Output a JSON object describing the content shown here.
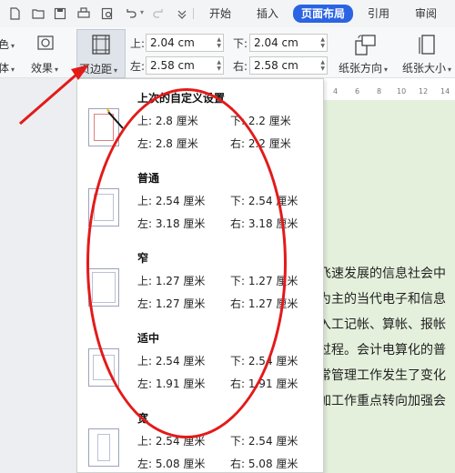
{
  "menubar": {
    "tabs": [
      {
        "label": "开始",
        "active": false
      },
      {
        "label": "插入",
        "active": false
      },
      {
        "label": "页面布局",
        "active": true
      },
      {
        "label": "引用",
        "active": false
      },
      {
        "label": "审阅",
        "active": false
      }
    ]
  },
  "ribbon": {
    "color_label": "色",
    "theme_label": "体",
    "effects_label": "效果",
    "margins_label": "页边距",
    "top_label": "上:",
    "top_value": "2.04 cm",
    "bottom_label": "下:",
    "bottom_value": "2.04 cm",
    "left_label": "左:",
    "left_value": "2.58 cm",
    "right_label": "右:",
    "right_value": "2.58 cm",
    "orientation_label": "纸张方向",
    "size_label": "纸张大小"
  },
  "ruler": {
    "ticks": [
      "4",
      "6",
      "8",
      "10",
      "12",
      "14"
    ]
  },
  "document": {
    "lines": [
      "飞速发展的信息社会中",
      "为主的当代电子和信息",
      "入工记帐、算帐、报帐",
      "过程。会计电算化的普",
      "常管理工作发生了变化",
      "加工作重点转向加强会"
    ]
  },
  "margin_presets": [
    {
      "title": "上次的自定义设置",
      "top": "上: 2.8 厘米",
      "bottom": "下: 2.2 厘米",
      "left": "左: 2.8 厘米",
      "right": "右: 2.2 厘米"
    },
    {
      "title": "普通",
      "top": "上: 2.54 厘米",
      "bottom": "下: 2.54 厘米",
      "left": "左: 3.18 厘米",
      "right": "右: 3.18 厘米"
    },
    {
      "title": "窄",
      "top": "上: 1.27 厘米",
      "bottom": "下: 1.27 厘米",
      "left": "左: 1.27 厘米",
      "right": "右: 1.27 厘米"
    },
    {
      "title": "适中",
      "top": "上: 2.54 厘米",
      "bottom": "下: 2.54 厘米",
      "left": "左: 1.91 厘米",
      "right": "右: 1.91 厘米"
    },
    {
      "title": "宽",
      "top": "上: 2.54 厘米",
      "bottom": "下: 2.54 厘米",
      "left": "左: 5.08 厘米",
      "right": "右: 5.08 厘米"
    }
  ],
  "colors": {
    "accent": "#2b64e3",
    "annotation": "#e31a1a",
    "page_bg": "#e4f0dc"
  }
}
